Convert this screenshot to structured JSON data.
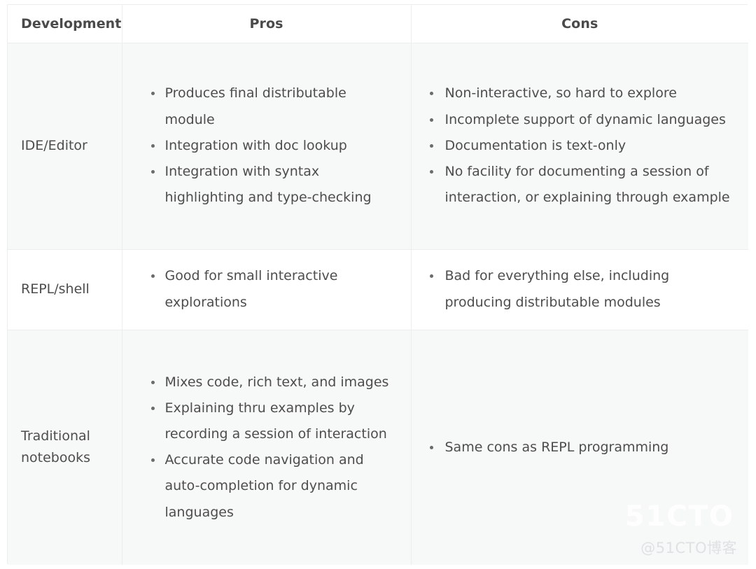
{
  "table": {
    "columns": [
      {
        "key": "development",
        "label": "Development",
        "align": "left"
      },
      {
        "key": "pros",
        "label": "Pros",
        "align": "center"
      },
      {
        "key": "cons",
        "label": "Cons",
        "align": "center"
      }
    ],
    "rows": [
      {
        "development": "IDE/Editor",
        "pros": [
          "Produces final distributable module",
          "Integration with doc lookup",
          "Integration with syntax highlighting and type-checking"
        ],
        "cons": [
          "Non-interactive, so hard to explore",
          "Incomplete support of dynamic languages",
          "Documentation is text-only",
          "No facility for documenting a session of interaction, or explaining through example"
        ]
      },
      {
        "development": "REPL/shell",
        "pros": [
          "Good for small interactive explorations"
        ],
        "cons": [
          "Bad for everything else, including producing distributable modules"
        ]
      },
      {
        "development": "Traditional notebooks",
        "pros": [
          "Mixes code, rich text, and images",
          "Explaining thru examples by recording a session of interaction",
          "Accurate code navigation and auto-completion for dynamic languages"
        ],
        "cons": [
          "Same cons as REPL programming"
        ]
      }
    ]
  },
  "watermark": {
    "logo": "51CTO",
    "credit": "@51CTO博客"
  },
  "colors": {
    "border": "#eceded",
    "row_shade": "#f7f8f8",
    "row_plain": "#ffffff",
    "text": "#4d4d4d",
    "header_text": "#4a4a4a",
    "bullet": "#6b6b6b",
    "watermark": "#dfe1e3"
  }
}
